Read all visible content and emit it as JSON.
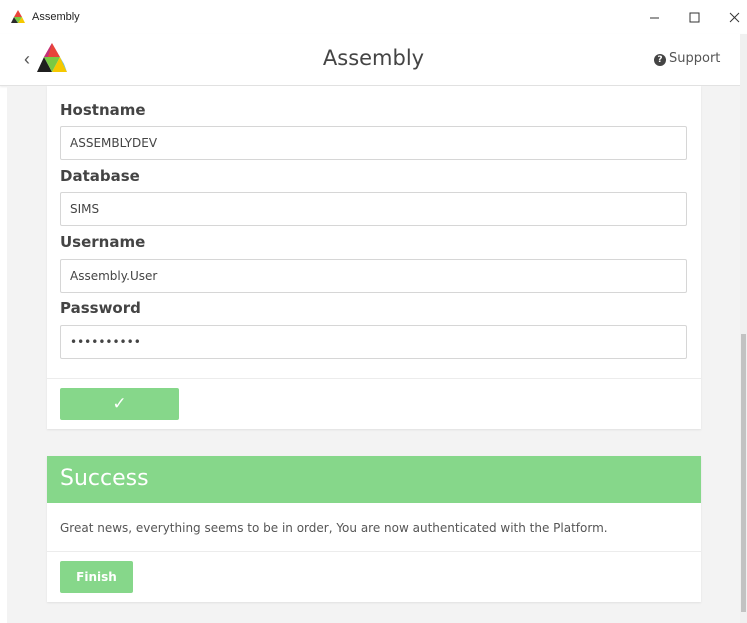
{
  "window": {
    "title": "Assembly",
    "minimize_icon": "minimize-icon",
    "maximize_icon": "maximize-icon",
    "close_icon": "close-icon"
  },
  "header": {
    "title": "Assembly",
    "back_icon": "chevron-left-icon",
    "back_glyph": "‹",
    "logo": "assembly-logo",
    "support_label": "Support",
    "support_icon": "question-circle-icon",
    "support_glyph": "?"
  },
  "form": {
    "fields": [
      {
        "label": "Hostname",
        "value": "ASSEMBLYDEV"
      },
      {
        "label": "Database",
        "value": "SIMS"
      },
      {
        "label": "Username",
        "value": "Assembly.User"
      },
      {
        "label": "Password",
        "value": "••••••••••"
      }
    ],
    "confirm_glyph": "✓",
    "confirm_icon": "checkmark-icon"
  },
  "success": {
    "title": "Success",
    "message": "Great news, everything seems to be in order, You are now authenticated with the Platform.",
    "finish_label": "Finish"
  },
  "colors": {
    "accent_green": "#86d78a",
    "background": "#f3f3f3"
  }
}
